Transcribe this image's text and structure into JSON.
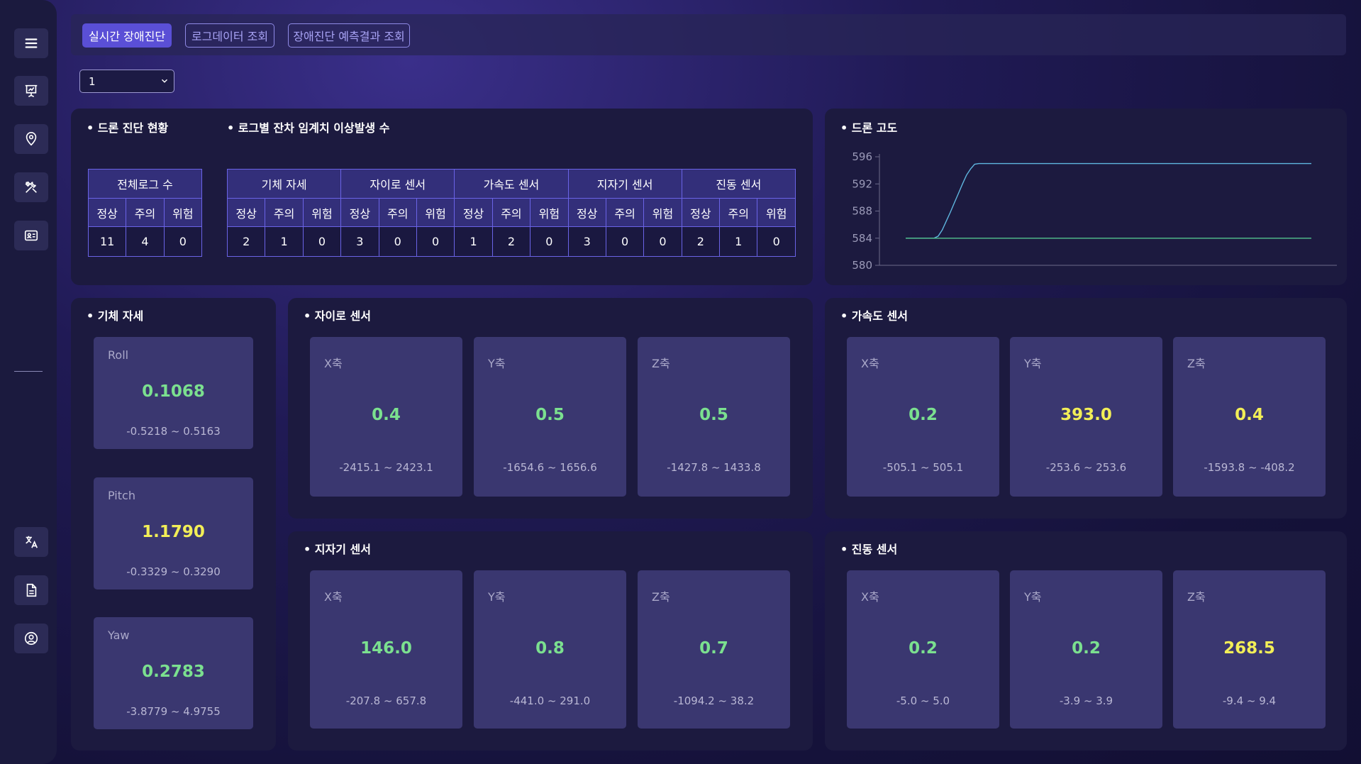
{
  "tabs": [
    "실시간 장애진단",
    "로그데이터 조회",
    "장애진단 예측결과 조회"
  ],
  "selector": {
    "value": "1"
  },
  "diagnosis": {
    "title": "• 드론 진단 현황",
    "total_header": "전체로그 수",
    "levels": [
      "정상",
      "주의",
      "위험"
    ],
    "total_values": [
      "11",
      "4",
      "0"
    ]
  },
  "threshold": {
    "title": "• 로그별 잔차 임계치 이상발생 수",
    "groups": [
      {
        "name": "기체 자세",
        "values": [
          "2",
          "1",
          "0"
        ]
      },
      {
        "name": "자이로 센서",
        "values": [
          "3",
          "0",
          "0"
        ]
      },
      {
        "name": "가속도 센서",
        "values": [
          "1",
          "2",
          "0"
        ]
      },
      {
        "name": "지자기 센서",
        "values": [
          "3",
          "0",
          "0"
        ]
      },
      {
        "name": "진동 센서",
        "values": [
          "2",
          "1",
          "0"
        ]
      }
    ]
  },
  "altitude": {
    "title": "• 드론 고도"
  },
  "chart_data": {
    "type": "line",
    "title": "",
    "xlabel": "",
    "ylabel": "",
    "ylim": [
      580,
      596
    ],
    "y_ticks": [
      580,
      584,
      588,
      592,
      596
    ],
    "grid": false,
    "series": [
      {
        "color": "#5fb6df",
        "x": [
          0,
          1,
          2,
          3,
          4,
          5,
          6,
          7,
          8,
          9,
          10,
          11,
          12,
          13,
          14,
          15,
          16,
          17,
          18,
          19,
          20,
          25,
          30,
          40,
          50,
          60,
          70,
          80,
          90,
          100
        ],
        "y": [
          584.0,
          584.0,
          584.0,
          584.0,
          584.0,
          584.0,
          584.0,
          584.0,
          584.3,
          585.2,
          586.5,
          587.8,
          589.2,
          590.6,
          592.0,
          593.3,
          594.2,
          594.9,
          595.0,
          595.0,
          595.0,
          595.0,
          595.0,
          595.0,
          595.0,
          595.0,
          595.0,
          595.0,
          595.0,
          595.0
        ]
      },
      {
        "color": "#52c48f",
        "x": [
          0,
          100
        ],
        "y": [
          584.0,
          584.0
        ]
      }
    ]
  },
  "attitude": {
    "title": "• 기체 자세",
    "cards": [
      {
        "label": "Roll",
        "value": "0.1068",
        "range": "-0.5218 ~ 0.5163",
        "status": "normal"
      },
      {
        "label": "Pitch",
        "value": "1.1790",
        "range": "-0.3329 ~ 0.3290",
        "status": "warning"
      },
      {
        "label": "Yaw",
        "value": "0.2783",
        "range": "-3.8779 ~ 4.9755",
        "status": "normal"
      }
    ]
  },
  "gyro": {
    "title": "• 자이로 센서",
    "cards": [
      {
        "label": "X축",
        "value": "0.4",
        "range": "-2415.1 ~ 2423.1",
        "status": "normal"
      },
      {
        "label": "Y축",
        "value": "0.5",
        "range": "-1654.6 ~ 1656.6",
        "status": "normal"
      },
      {
        "label": "Z축",
        "value": "0.5",
        "range": "-1427.8 ~ 1433.8",
        "status": "normal"
      }
    ]
  },
  "accel": {
    "title": "• 가속도 센서",
    "cards": [
      {
        "label": "X축",
        "value": "0.2",
        "range": "-505.1 ~ 505.1",
        "status": "normal"
      },
      {
        "label": "Y축",
        "value": "393.0",
        "range": "-253.6 ~ 253.6",
        "status": "warning"
      },
      {
        "label": "Z축",
        "value": "0.4",
        "range": "-1593.8 ~ -408.2",
        "status": "warning"
      }
    ]
  },
  "mag": {
    "title": "• 지자기 센서",
    "cards": [
      {
        "label": "X축",
        "value": "146.0",
        "range": "-207.8 ~ 657.8",
        "status": "normal"
      },
      {
        "label": "Y축",
        "value": "0.8",
        "range": "-441.0 ~ 291.0",
        "status": "normal"
      },
      {
        "label": "Z축",
        "value": "0.7",
        "range": "-1094.2 ~ 38.2",
        "status": "normal"
      }
    ]
  },
  "vibration": {
    "title": "• 진동 센서",
    "cards": [
      {
        "label": "X축",
        "value": "0.2",
        "range": "-5.0 ~ 5.0",
        "status": "normal"
      },
      {
        "label": "Y축",
        "value": "0.2",
        "range": "-3.9 ~ 3.9",
        "status": "normal"
      },
      {
        "label": "Z축",
        "value": "268.5",
        "range": "-9.4 ~ 9.4",
        "status": "warning"
      }
    ]
  },
  "colors": {
    "normal": "#7be08f",
    "warning": "#f2ee57",
    "accent": "#5a4fd6"
  },
  "sidebar_icons": [
    "menu-icon",
    "presentation-chart-icon",
    "location-pin-icon",
    "tools-icon",
    "id-card-icon",
    "translate-icon",
    "document-icon",
    "user-circle-icon"
  ]
}
